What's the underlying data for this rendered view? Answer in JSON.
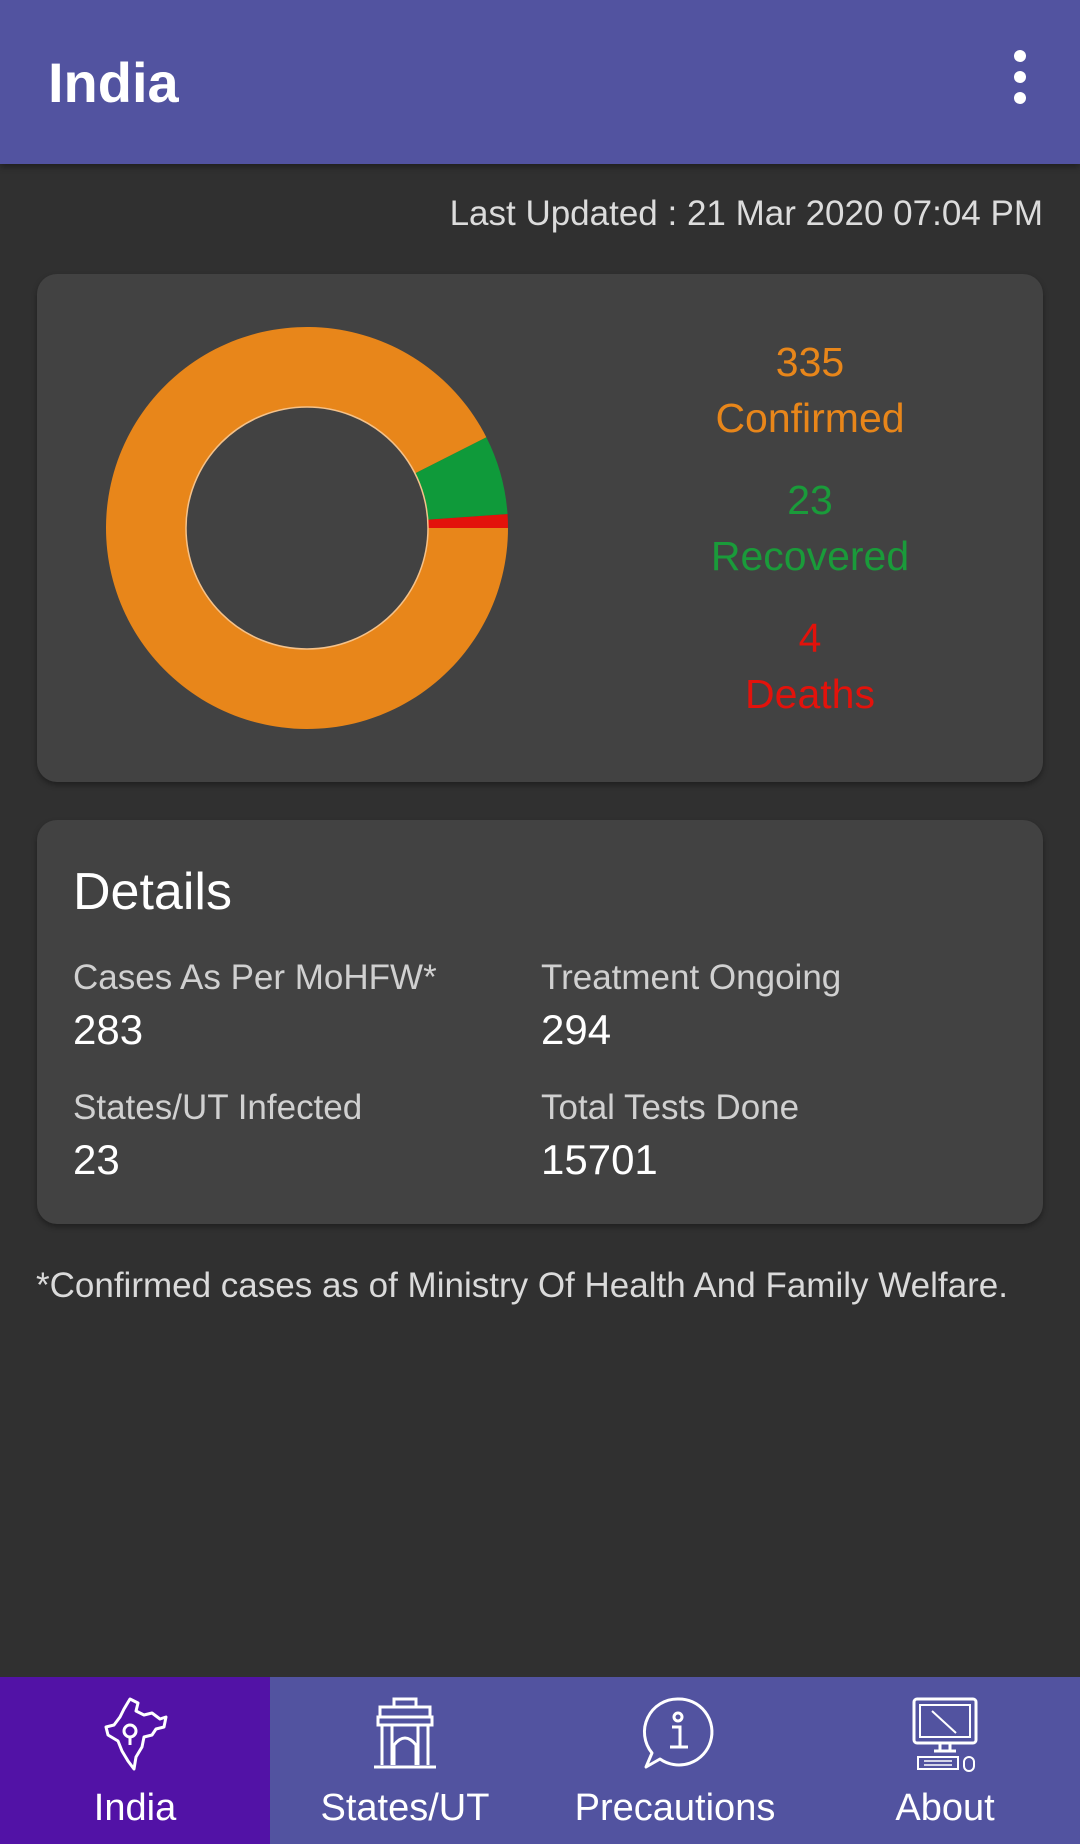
{
  "appbar": {
    "title": "India",
    "menu_icon": "more-vert-icon"
  },
  "last_updated": "Last Updated : 21 Mar 2020 07:04 PM",
  "summary": {
    "confirmed": {
      "value": "335",
      "label": "Confirmed",
      "color": "#e8861a"
    },
    "recovered": {
      "value": "23",
      "label": "Recovered",
      "color": "#1a9b3a"
    },
    "deaths": {
      "value": "4",
      "label": "Deaths",
      "color": "#e3120b"
    }
  },
  "chart_data": {
    "type": "pie",
    "donut": true,
    "categories": [
      "Confirmed",
      "Recovered",
      "Deaths"
    ],
    "values": [
      335,
      23,
      4
    ],
    "colors": [
      "#e8861a",
      "#0f9a3a",
      "#e3120b"
    ]
  },
  "details": {
    "heading": "Details",
    "items": [
      {
        "label": "Cases As Per MoHFW*",
        "value": "283"
      },
      {
        "label": "Treatment Ongoing",
        "value": "294"
      },
      {
        "label": "States/UT Infected",
        "value": "23"
      },
      {
        "label": "Total Tests Done",
        "value": "15701"
      }
    ]
  },
  "footnote": "*Confirmed cases as of Ministry Of Health And Family Welfare.",
  "nav": {
    "items": [
      {
        "label": "India",
        "icon": "india-map-icon",
        "active": true
      },
      {
        "label": "States/UT",
        "icon": "gateway-icon",
        "active": false
      },
      {
        "label": "Precautions",
        "icon": "info-bubble-icon",
        "active": false
      },
      {
        "label": "About",
        "icon": "computer-icon",
        "active": false
      }
    ]
  }
}
